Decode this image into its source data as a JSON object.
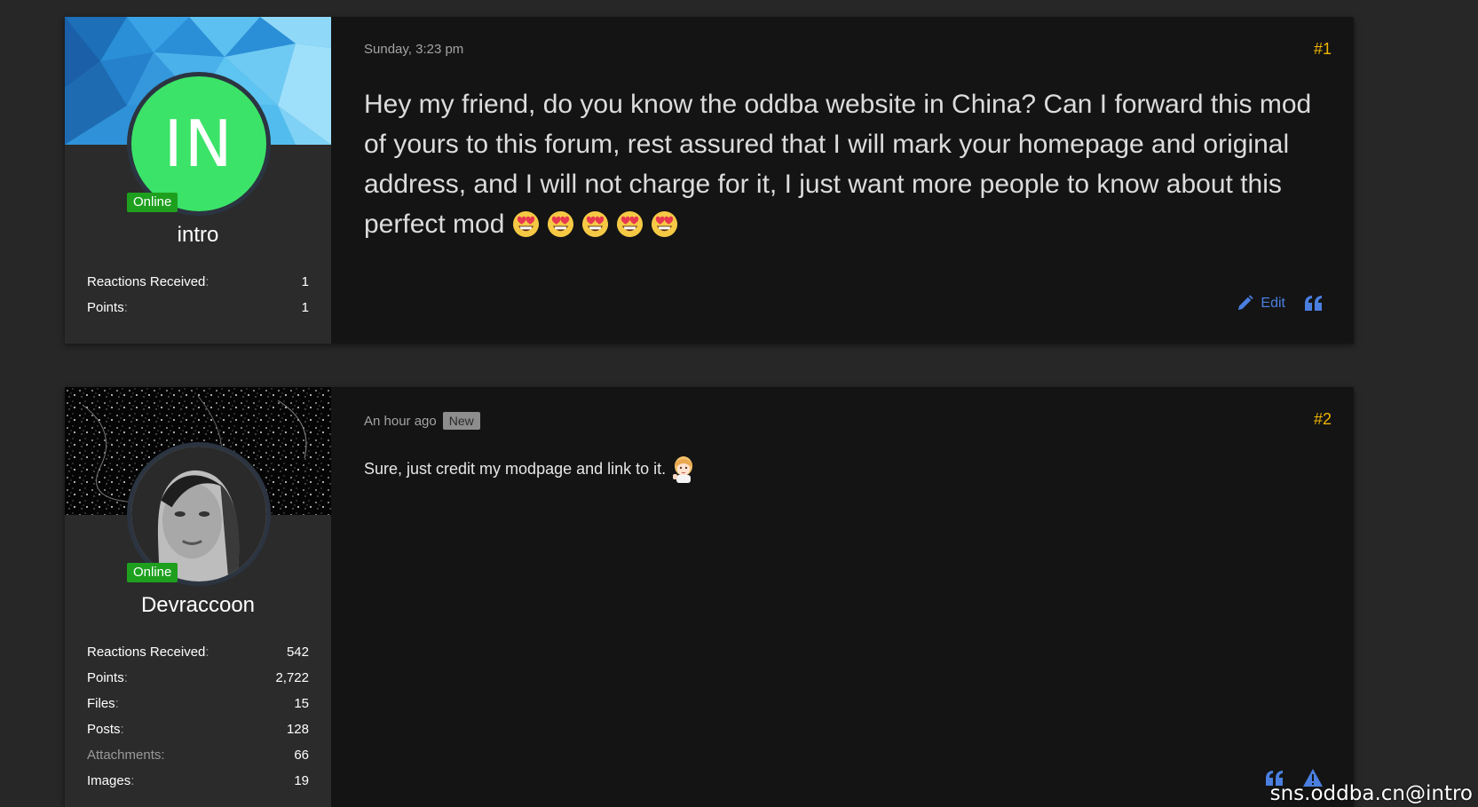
{
  "posts": [
    {
      "user": {
        "initials": "IN",
        "status": "Online",
        "name": "intro",
        "stats": [
          {
            "label": "Reactions Received",
            "value": "1"
          },
          {
            "label": "Points",
            "value": "1"
          }
        ]
      },
      "date": "Sunday, 3:23 pm",
      "number": "#1",
      "message": "Hey my friend, do you know the oddba website in China? Can I forward this mod of yours to this forum, rest assured that I will mark your homepage and original address, and I will not charge for it, I just want more people to know about this perfect mod",
      "emoji": "heart-eyes-emoji",
      "emoji_count": 5,
      "actions": {
        "edit_label": "Edit"
      }
    },
    {
      "user": {
        "status": "Online",
        "name": "Devraccoon",
        "stats": [
          {
            "label": "Reactions Received",
            "value": "542"
          },
          {
            "label": "Points",
            "value": "2,722"
          },
          {
            "label": "Files",
            "value": "15"
          },
          {
            "label": "Posts",
            "value": "128"
          },
          {
            "label": "Attachments",
            "value": "66"
          },
          {
            "label": "Images",
            "value": "19"
          }
        ]
      },
      "date": "An hour ago",
      "new_badge": "New",
      "number": "#2",
      "message": "Sure, just credit my modpage and link to it."
    }
  ],
  "watermark": "sns.oddba.cn@intro",
  "colors": {
    "background": "#272727",
    "user_panel": "#2b2b2b",
    "message_panel": "#141414",
    "accent_link": "#4a7fe0",
    "post_number": "#f0b400",
    "online_badge": "#1ea01e",
    "avatar_intro": "#3be368"
  }
}
